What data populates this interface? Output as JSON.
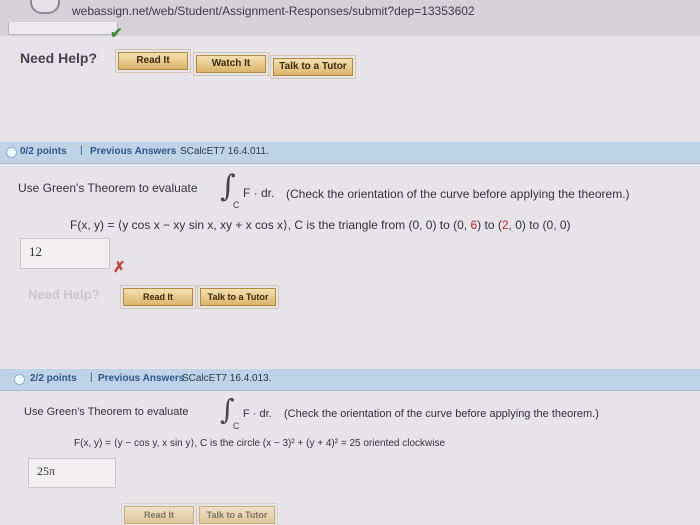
{
  "browser": {
    "url": "webassign.net/web/Student/Assignment-Responses/submit?dep=13353602"
  },
  "top_help": {
    "need_help": "Need Help?",
    "read_it": "Read It",
    "watch_it": "Watch It",
    "talk_to_tutor": "Talk to a Tutor"
  },
  "q1": {
    "points": "0/2 points",
    "sep": "|",
    "previous_answers": "Previous Answers",
    "code": "SCalcET7 16.4.011.",
    "prompt": "Use Green's Theorem to evaluate",
    "integral_sub": "C",
    "integrand": "F · dr.",
    "note": "(Check the orientation of the curve before applying the theorem.)",
    "function_a": "F(x, y) = ⟨y cos x − xy sin x, xy + x cos x⟩, C is the triangle from (0, 0) to (0, ",
    "function_red1": "6",
    "function_b": ") to (",
    "function_red2": "2",
    "function_c": ", 0) to (0, 0)",
    "answer": "12",
    "need_help": "Need Help?",
    "read_it": "Read It",
    "talk_to_tutor": "Talk to a Tutor"
  },
  "q2": {
    "points": "2/2 points",
    "sep": "|",
    "previous_answers": "Previous Answers",
    "code": "SCalcET7 16.4.013.",
    "prompt": "Use Green's Theorem to evaluate",
    "integral_sub": "C",
    "integrand": "F · dr.",
    "note": "(Check the orientation of the curve before applying the theorem.)",
    "function": "F(x, y) = ⟨y − cos y, x sin y⟩, C is the circle (x − 3)² + (y + 4)² = 25 oriented clockwise",
    "answer": "25π",
    "read_it": "Read It",
    "talk_to_tutor": "Talk to a Tutor"
  },
  "colors": {
    "header_bar": "#bfd2e6",
    "link_blue": "#2a5a8c",
    "wrong_red": "#c2262b",
    "correct_green": "#3a8a3a"
  }
}
